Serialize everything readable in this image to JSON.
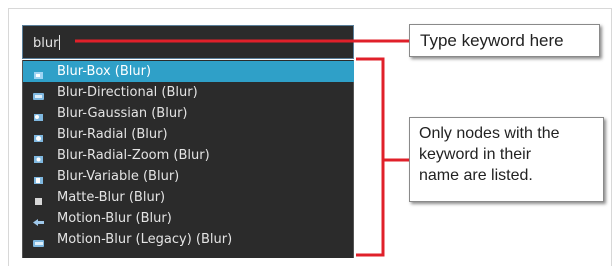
{
  "search": {
    "value": "blur"
  },
  "results": [
    {
      "label": "Blur-Box (Blur)",
      "icon": "blur-box-node-icon",
      "selected": true
    },
    {
      "label": "Blur-Directional (Blur)",
      "icon": "blur-directional-node-icon"
    },
    {
      "label": "Blur-Gaussian (Blur)",
      "icon": "blur-gaussian-node-icon"
    },
    {
      "label": "Blur-Radial (Blur)",
      "icon": "blur-radial-node-icon"
    },
    {
      "label": "Blur-Radial-Zoom (Blur)",
      "icon": "blur-radial-zoom-node-icon"
    },
    {
      "label": "Blur-Variable (Blur)",
      "icon": "blur-variable-node-icon"
    },
    {
      "label": "Matte-Blur (Blur)",
      "icon": "matte-blur-node-icon"
    },
    {
      "label": "Motion-Blur (Blur)",
      "icon": "motion-blur-node-icon"
    },
    {
      "label": "Motion-Blur (Legacy) (Blur)",
      "icon": "motion-blur-legacy-node-icon"
    }
  ],
  "callouts": {
    "search_hint": "Type keyword here",
    "list_hint_lines": [
      "Only nodes with the",
      "keyword in their",
      "name are listed."
    ]
  },
  "colors": {
    "annotation_line": "#e0202a",
    "selection": "#2fa0c8",
    "list_background": "#2b2b2b"
  }
}
